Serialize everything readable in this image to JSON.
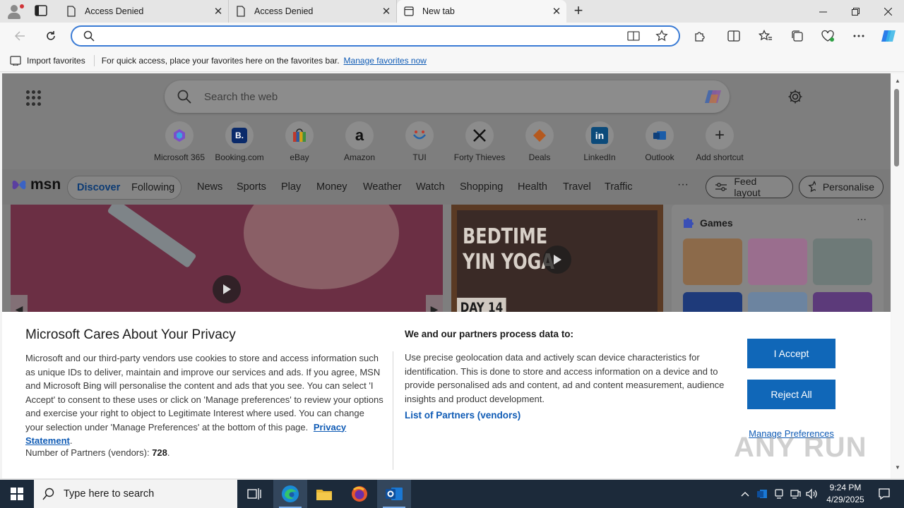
{
  "browser": {
    "tabs": [
      {
        "label": "Access Denied",
        "icon": "page-icon",
        "active": false
      },
      {
        "label": "Access Denied",
        "icon": "page-icon",
        "active": false
      },
      {
        "label": "New tab",
        "icon": "newtab-icon",
        "active": true
      }
    ],
    "address_value": "",
    "window_controls": [
      "minimize-icon",
      "restore-icon",
      "close-icon"
    ],
    "accent": "#3a7bd5"
  },
  "favorites_bar": {
    "import_label": "Import favorites",
    "message": "For quick access, place your favorites here on the favorites bar.",
    "manage_link": "Manage favorites now"
  },
  "newtab": {
    "search_placeholder": "Search the web",
    "shortcuts": [
      {
        "label": "Microsoft 365",
        "icon": "m365-icon"
      },
      {
        "label": "Booking.com",
        "icon": "booking-icon",
        "glyph": "B."
      },
      {
        "label": "eBay",
        "icon": "ebay-icon"
      },
      {
        "label": "Amazon",
        "icon": "amazon-icon",
        "glyph": "a"
      },
      {
        "label": "TUI",
        "icon": "tui-icon"
      },
      {
        "label": "Forty Thieves",
        "icon": "forty-thieves-icon"
      },
      {
        "label": "Deals",
        "icon": "deals-icon"
      },
      {
        "label": "LinkedIn",
        "icon": "linkedin-icon",
        "glyph": "in"
      },
      {
        "label": "Outlook",
        "icon": "outlook-icon"
      },
      {
        "label": "Add shortcut",
        "icon": "plus-icon",
        "glyph": "+"
      }
    ]
  },
  "msn": {
    "logo": "msn",
    "discover": "Discover",
    "following": "Following",
    "nav": [
      "News",
      "Sports",
      "Play",
      "Money",
      "Weather",
      "Watch",
      "Shopping",
      "Health",
      "Travel",
      "Traffic"
    ],
    "more": "···",
    "feed_layout": "Feed layout",
    "personalise": "Personalise",
    "cards": {
      "yoga_line1": "BEDTIME",
      "yoga_line2": "YIN YOGA",
      "yoga_day": "DAY 14"
    },
    "games": {
      "title": "Games",
      "more": "···"
    }
  },
  "privacy": {
    "title": "Microsoft Cares About Your Privacy",
    "body": "Microsoft and our third-party vendors use cookies to store and access information such as unique IDs to deliver, maintain and improve our services and ads. If you agree, MSN and Microsoft Bing will personalise the content and ads that you see. You can select 'I Accept' to consent to these uses or click on 'Manage preferences' to review your options and exercise your right to object to Legitimate Interest where used.  You can change your selection under 'Manage Preferences' at the bottom of this page.",
    "privacy_link": "Privacy Statement",
    "partners_label": "Number of Partners (vendors): ",
    "partners_count": "728",
    "process_title": "We and our partners process data to:",
    "process_body": "Use precise geolocation data and actively scan device characteristics for identification. This is done to store and access information on a device and to provide personalised ads and content, ad and content measurement, audience insights and product development.",
    "list_partners": "List of Partners (vendors)",
    "accept": "I Accept",
    "reject": "Reject All",
    "manage": "Manage Preferences",
    "button_color": "#1067b8"
  },
  "watermark": "ANY RUN",
  "taskbar": {
    "search_placeholder": "Type here to search",
    "apps": [
      "task-view-icon",
      "edge-icon",
      "file-explorer-icon",
      "firefox-icon",
      "outlook-icon"
    ],
    "time": "9:24 PM",
    "date": "4/29/2025"
  }
}
